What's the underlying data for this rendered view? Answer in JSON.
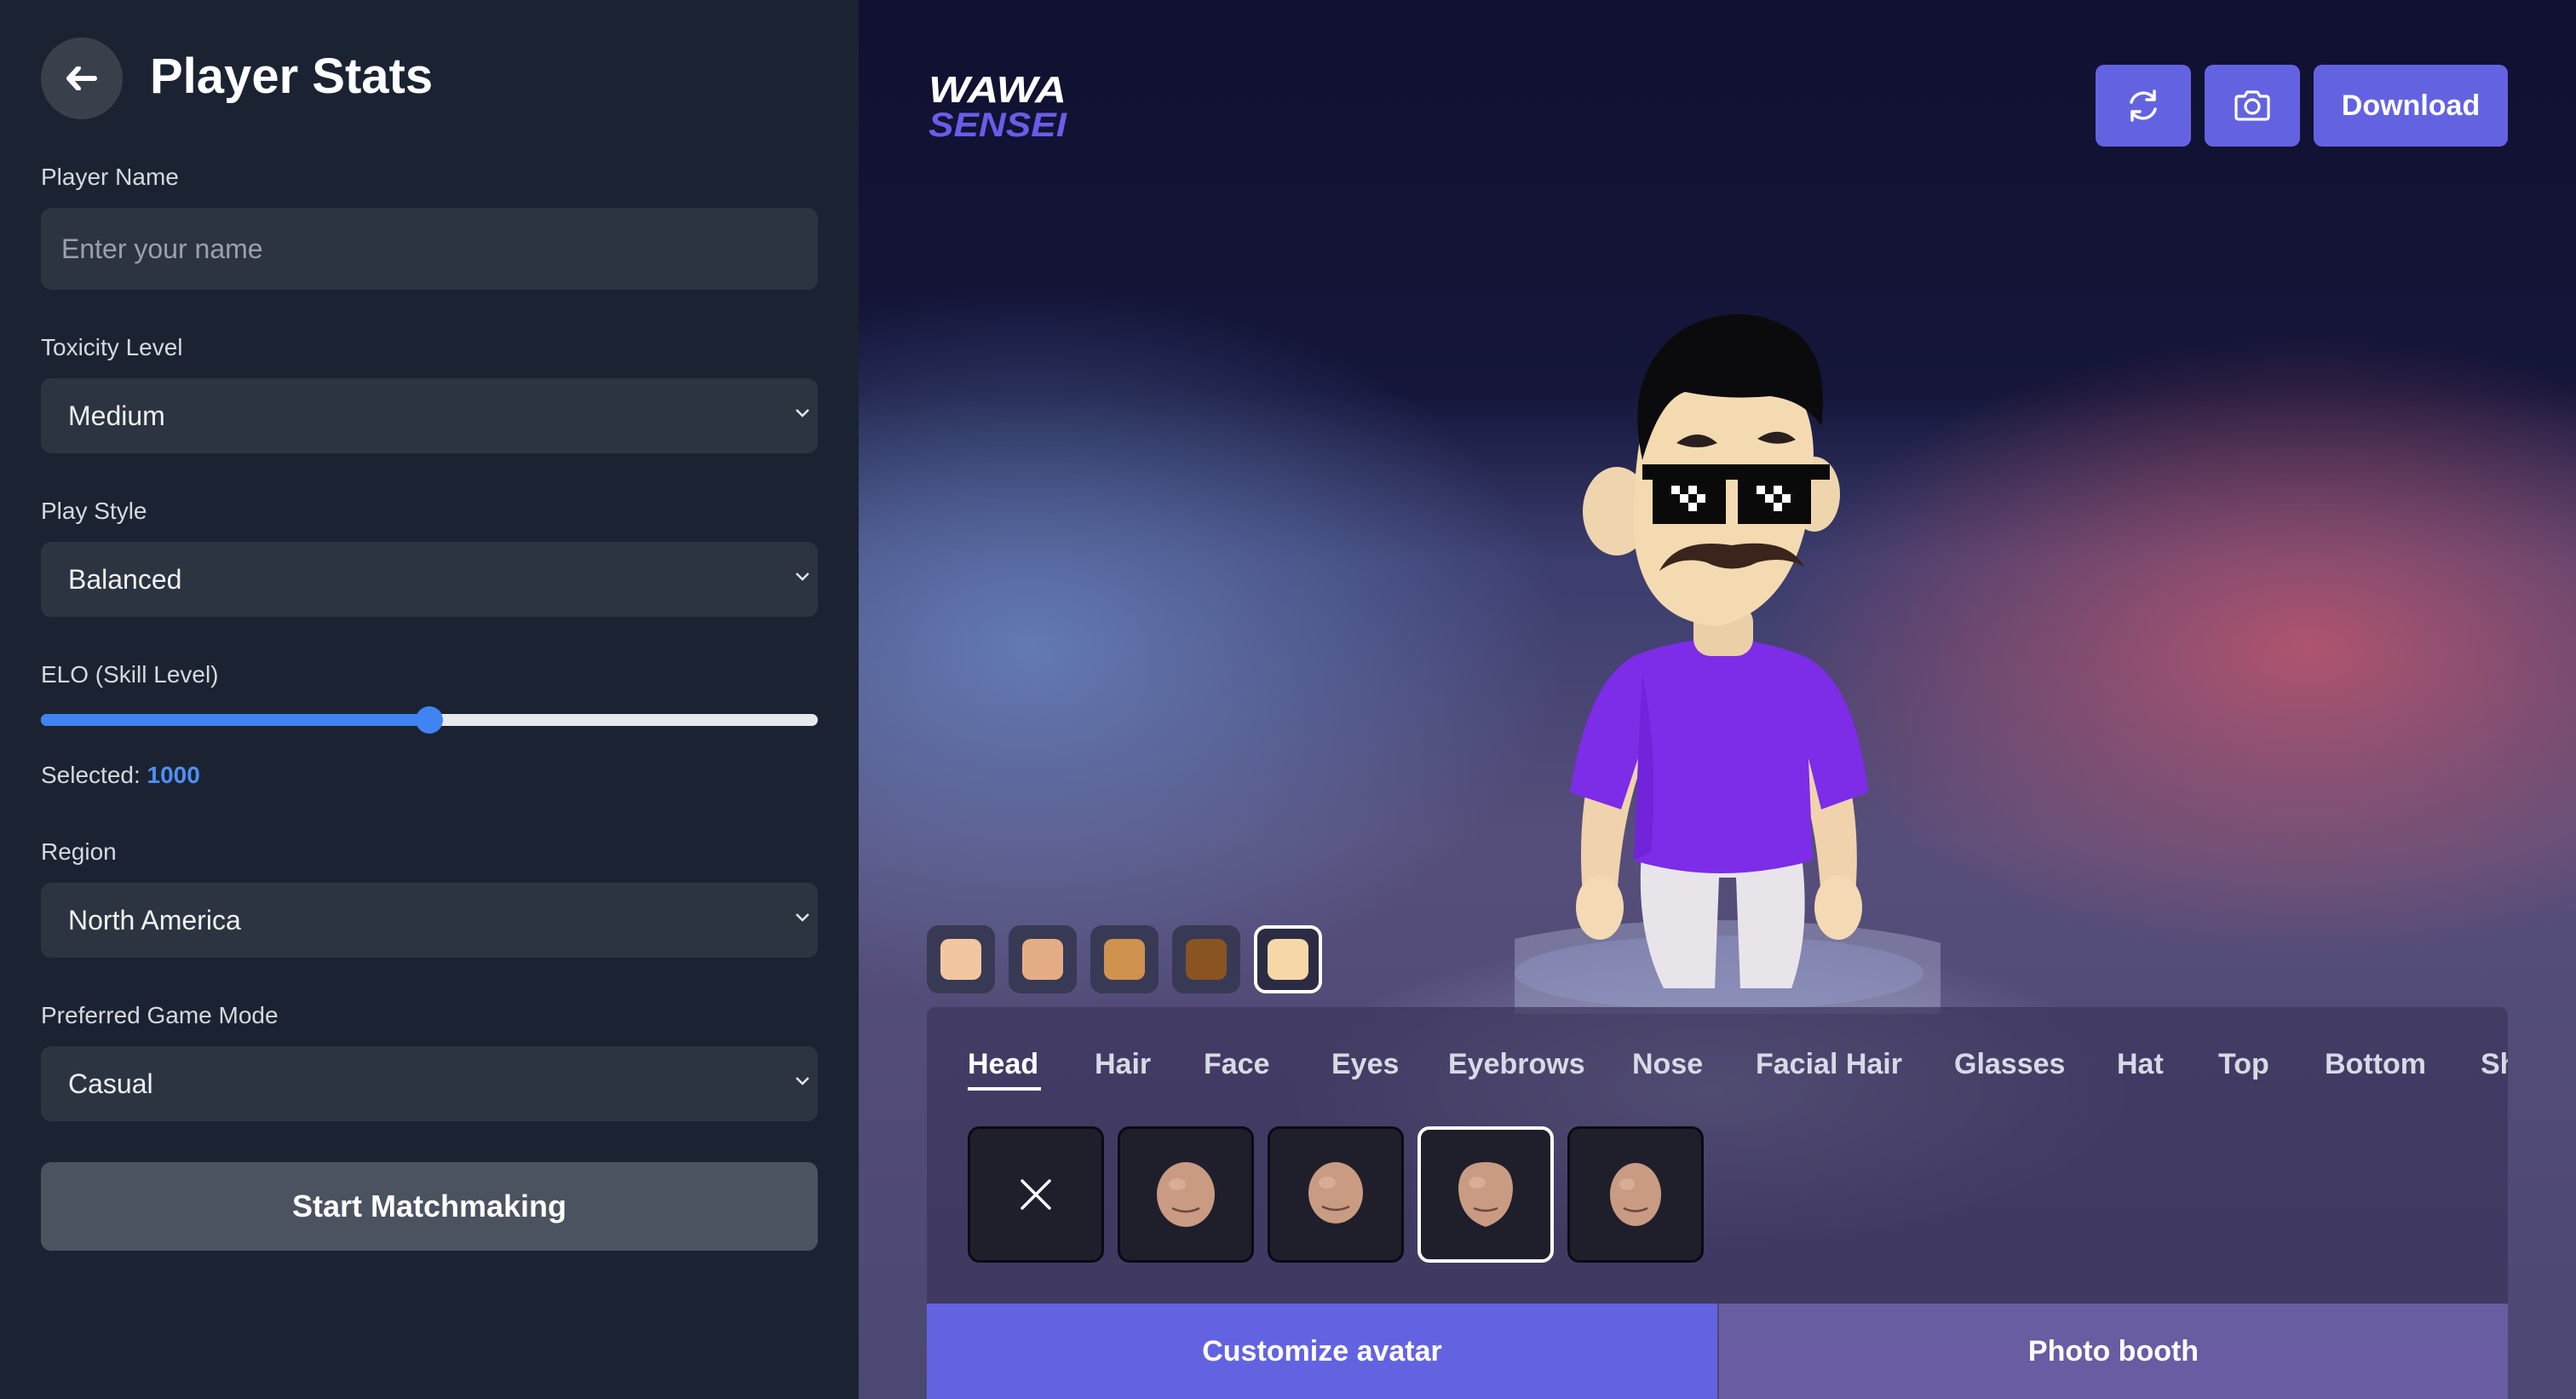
{
  "sidebar": {
    "title": "Player Stats",
    "player_name": {
      "label": "Player Name",
      "placeholder": "Enter your name",
      "value": ""
    },
    "toxicity": {
      "label": "Toxicity Level",
      "value": "Medium"
    },
    "play_style": {
      "label": "Play Style",
      "value": "Balanced"
    },
    "elo": {
      "label": "ELO (Skill Level)",
      "selected_prefix": "Selected:",
      "value": "1000",
      "fraction": 0.5
    },
    "region": {
      "label": "Region",
      "value": "North America"
    },
    "game_mode": {
      "label": "Preferred Game Mode",
      "value": "Casual"
    },
    "start_button": "Start Matchmaking"
  },
  "stage": {
    "logo_text": [
      "WAWA",
      "SENSEI"
    ],
    "download_label": "Download",
    "skin_tones": [
      "#f2c6a1",
      "#e4ad86",
      "#d0934f",
      "#8a5322",
      "#f6d8a8"
    ],
    "selected_skin_tone": 4,
    "categories": [
      "Head",
      "Hair",
      "Face",
      "Eyes",
      "Eyebrows",
      "Nose",
      "Facial Hair",
      "Glasses",
      "Hat",
      "Top",
      "Bottom",
      "Sh"
    ],
    "active_category": "Head",
    "selected_option": 3,
    "bottom_tabs": [
      "Customize avatar",
      "Photo booth"
    ]
  },
  "colors": {
    "accent": "#6363e2",
    "slider": "#3f84f1",
    "shirt": "#7d2ce8"
  }
}
